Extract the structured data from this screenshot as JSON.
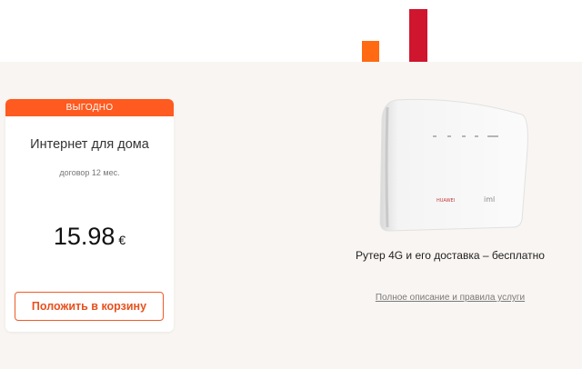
{
  "card": {
    "badge": "ВЫГОДНО",
    "title": "Интернет для дома",
    "contract": "договор 12 мес.",
    "price": "15.98",
    "currency": "€",
    "cart_button": "Положить в корзину"
  },
  "product": {
    "caption": "Рутер 4G и его доставка – бесплатно",
    "details_link": "Полное описание и правила услуги",
    "router_brand": "HUAWEI",
    "router_logo": "iml"
  },
  "colors": {
    "accent": "#ff5a1f",
    "button_text": "#e8501e",
    "deco_red": "#d0152e",
    "background": "#f9f5f2"
  }
}
